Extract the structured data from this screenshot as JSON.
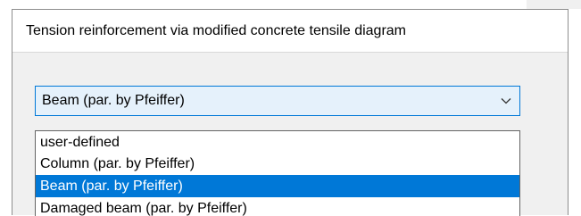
{
  "dialog": {
    "title": "Tension reinforcement via modified concrete tensile diagram"
  },
  "combo": {
    "selected_value": "Beam (par. by Pfeiffer)",
    "arrow_icon": "chevron-down-icon"
  },
  "dropdown": {
    "options": [
      {
        "label": "user-defined"
      },
      {
        "label": "Column (par. by Pfeiffer)"
      },
      {
        "label": "Beam (par. by Pfeiffer)"
      },
      {
        "label": "Damaged beam (par. by Pfeiffer)"
      }
    ],
    "selected_index": 2
  },
  "colors": {
    "highlight": "#0078d7",
    "combo_background": "#e5f1fb",
    "dialog_background": "#f0f0f0"
  }
}
